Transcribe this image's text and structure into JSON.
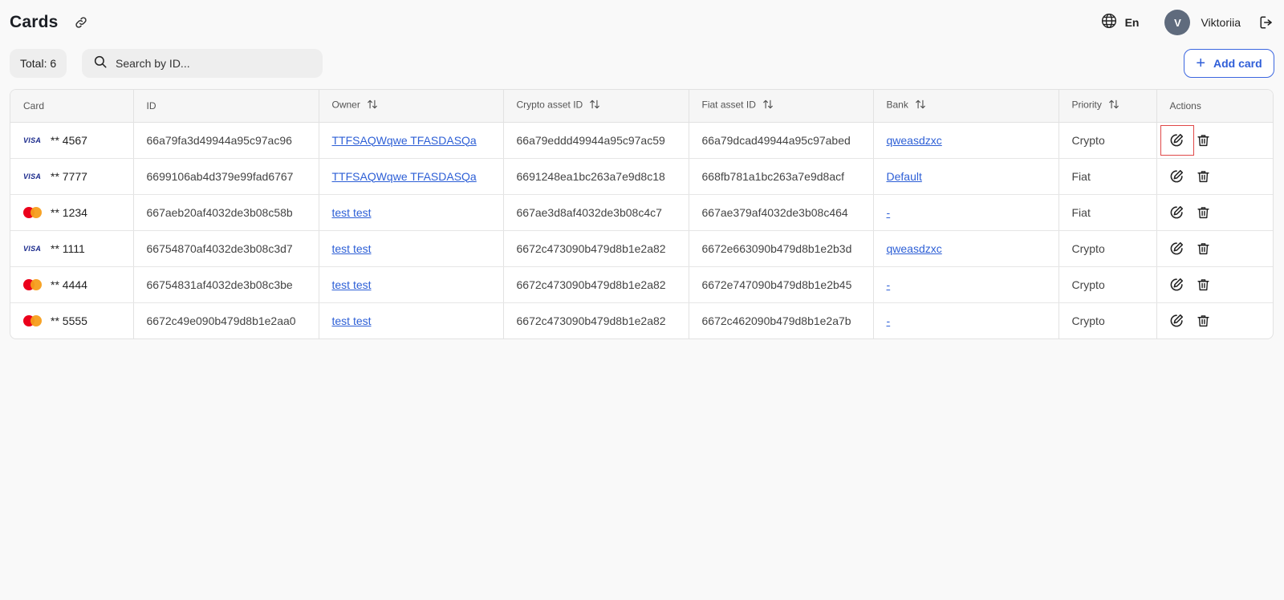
{
  "header": {
    "title": "Cards",
    "language": "En",
    "user": {
      "initial": "V",
      "name": "Viktoriia"
    }
  },
  "toolbar": {
    "total_label": "Total: 6",
    "search_placeholder": "Search by ID...",
    "add_button_label": "Add card"
  },
  "table": {
    "columns": [
      {
        "label": "Card",
        "sortable": false
      },
      {
        "label": "ID",
        "sortable": false
      },
      {
        "label": "Owner",
        "sortable": true
      },
      {
        "label": "Crypto asset ID",
        "sortable": true
      },
      {
        "label": "Fiat asset ID",
        "sortable": true
      },
      {
        "label": "Bank",
        "sortable": true
      },
      {
        "label": "Priority",
        "sortable": true
      },
      {
        "label": "Actions",
        "sortable": false
      }
    ],
    "rows": [
      {
        "brand": "visa",
        "brand_text": "VISA",
        "card": "** 4567",
        "id": "66a79fa3d49944a95c97ac96",
        "owner": "TTFSAQWqwe TFASDASQa",
        "crypto_asset_id": "66a79eddd49944a95c97ac59",
        "fiat_asset_id": "66a79dcad49944a95c97abed",
        "bank": "qweasdzxc",
        "priority": "Crypto",
        "edit_highlighted": true
      },
      {
        "brand": "visa",
        "brand_text": "VISA",
        "card": "** 7777",
        "id": "6699106ab4d379e99fad6767",
        "owner": "TTFSAQWqwe TFASDASQa",
        "crypto_asset_id": "6691248ea1bc263a7e9d8c18",
        "fiat_asset_id": "668fb781a1bc263a7e9d8acf",
        "bank": "Default",
        "priority": "Fiat",
        "edit_highlighted": false
      },
      {
        "brand": "mastercard",
        "brand_text": "",
        "card": "** 1234",
        "id": "667aeb20af4032de3b08c58b",
        "owner": "test test",
        "crypto_asset_id": "667ae3d8af4032de3b08c4c7",
        "fiat_asset_id": "667ae379af4032de3b08c464",
        "bank": "-",
        "priority": "Fiat",
        "edit_highlighted": false
      },
      {
        "brand": "visa",
        "brand_text": "VISA",
        "card": "** 1111",
        "id": "66754870af4032de3b08c3d7",
        "owner": "test test",
        "crypto_asset_id": "6672c473090b479d8b1e2a82",
        "fiat_asset_id": "6672e663090b479d8b1e2b3d",
        "bank": "qweasdzxc",
        "priority": "Crypto",
        "edit_highlighted": false
      },
      {
        "brand": "mastercard",
        "brand_text": "",
        "card": "** 4444",
        "id": "66754831af4032de3b08c3be",
        "owner": "test test",
        "crypto_asset_id": "6672c473090b479d8b1e2a82",
        "fiat_asset_id": "6672e747090b479d8b1e2b45",
        "bank": "-",
        "priority": "Crypto",
        "edit_highlighted": false
      },
      {
        "brand": "mastercard",
        "brand_text": "",
        "card": "** 5555",
        "id": "6672c49e090b479d8b1e2aa0",
        "owner": "test test",
        "crypto_asset_id": "6672c473090b479d8b1e2a82",
        "fiat_asset_id": "6672c462090b479d8b1e2a7b",
        "bank": "-",
        "priority": "Crypto",
        "edit_highlighted": false
      }
    ]
  },
  "colors": {
    "accent": "#2f5ed8",
    "link": "#2d5fd6",
    "avatar": "#5f6b7d",
    "highlight": "#e04848",
    "visa": "#1a2a8c",
    "mc_red": "#eb001b",
    "mc_orange": "#f79e1b"
  }
}
